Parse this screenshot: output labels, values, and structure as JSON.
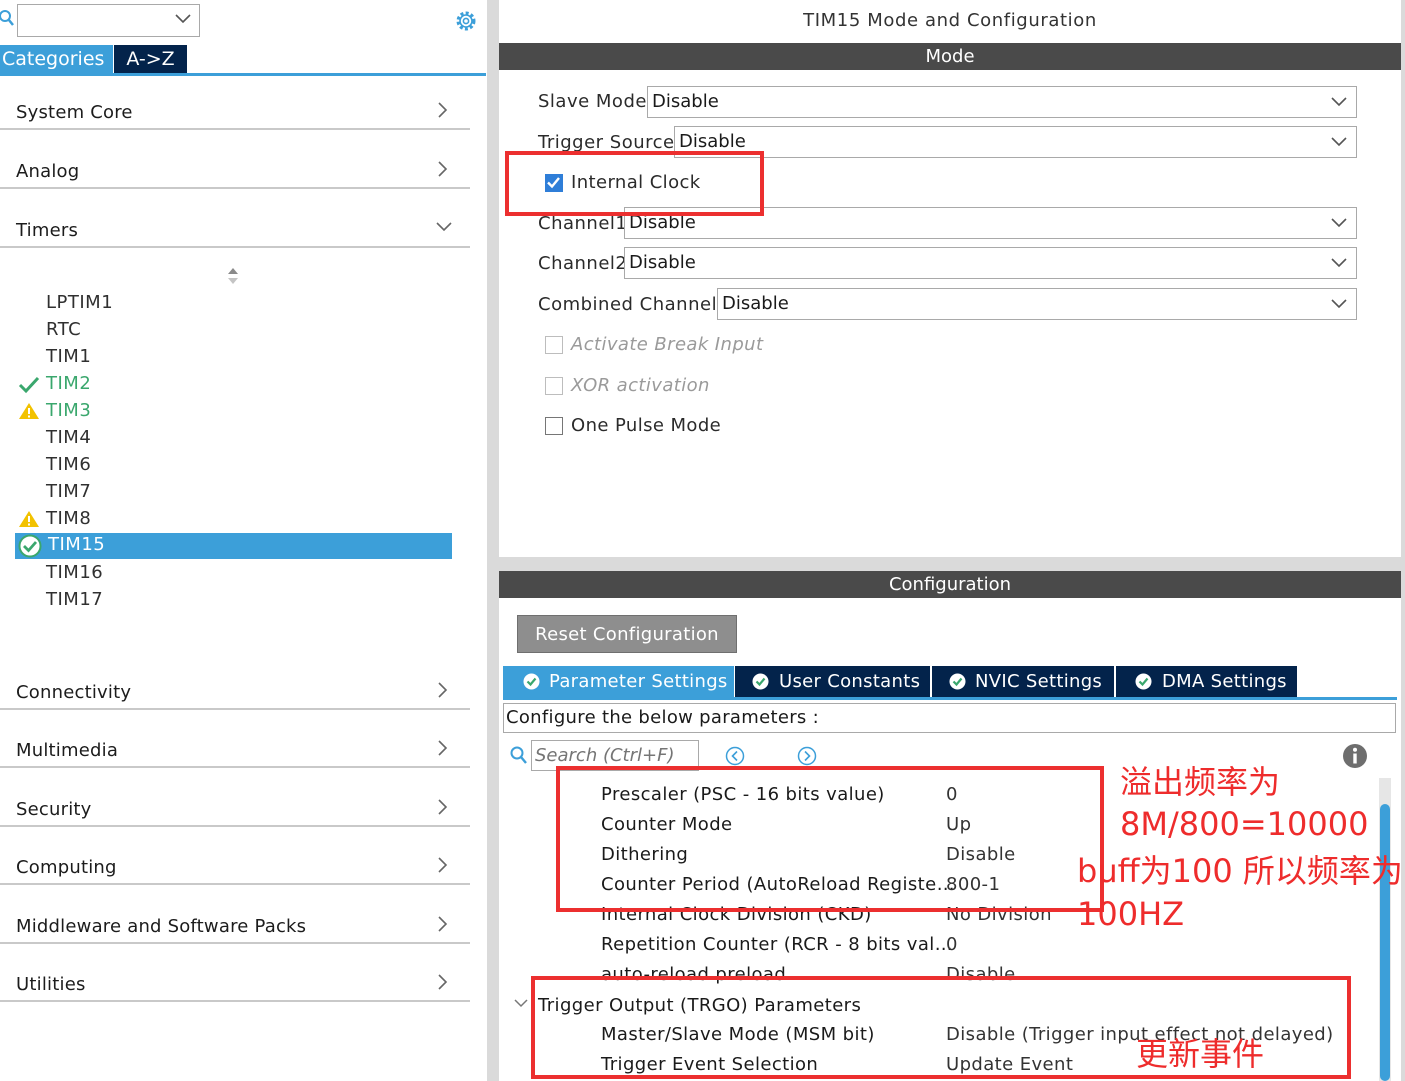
{
  "left_panel": {
    "combo_value": "",
    "tabs": {
      "categories": "Categories",
      "az": "A->Z"
    },
    "categories_top": [
      "System Core",
      "Analog",
      "Timers"
    ],
    "timers": [
      {
        "name": "LPTIM1",
        "status": "none"
      },
      {
        "name": "RTC",
        "status": "none"
      },
      {
        "name": "TIM1",
        "status": "none"
      },
      {
        "name": "TIM2",
        "status": "ok"
      },
      {
        "name": "TIM3",
        "status": "warning"
      },
      {
        "name": "TIM4",
        "status": "none"
      },
      {
        "name": "TIM6",
        "status": "none"
      },
      {
        "name": "TIM7",
        "status": "none"
      },
      {
        "name": "TIM8",
        "status": "warning"
      },
      {
        "name": "TIM15",
        "status": "selected-ok"
      },
      {
        "name": "TIM16",
        "status": "none"
      },
      {
        "name": "TIM17",
        "status": "none"
      }
    ],
    "categories_bottom": [
      "Connectivity",
      "Multimedia",
      "Security",
      "Computing",
      "Middleware and Software Packs",
      "Utilities"
    ]
  },
  "mode": {
    "title": "TIM15 Mode and Configuration",
    "bar": "Mode",
    "slave_mode": {
      "label": "Slave Mode",
      "value": "Disable"
    },
    "trigger_source": {
      "label": "Trigger Source",
      "value": "Disable"
    },
    "internal_clock": {
      "label": "Internal Clock",
      "checked": true
    },
    "channel1": {
      "label": "Channel1",
      "value": "Disable"
    },
    "channel2": {
      "label": "Channel2",
      "value": "Disable"
    },
    "combined_channels": {
      "label": "Combined Channels",
      "value": "Disable"
    },
    "activate_break_input": {
      "label": "Activate Break Input",
      "checked": false,
      "enabled": false
    },
    "xor_activation": {
      "label": "XOR activation",
      "checked": false,
      "enabled": false
    },
    "one_pulse_mode": {
      "label": "One Pulse Mode",
      "checked": false,
      "enabled": true
    }
  },
  "config": {
    "bar": "Configuration",
    "reset_button": "Reset Configuration",
    "tabs": [
      "Parameter Settings",
      "User Constants",
      "NVIC Settings",
      "DMA Settings"
    ],
    "description": "Configure the below parameters :",
    "search_placeholder": "Search (Ctrl+F)",
    "params": [
      {
        "name": "Prescaler (PSC - 16 bits value)",
        "value": "0"
      },
      {
        "name": "Counter Mode",
        "value": "Up"
      },
      {
        "name": "Dithering",
        "value": "Disable"
      },
      {
        "name": "Counter Period (AutoReload Registe…",
        "value": "800-1"
      },
      {
        "name": "Internal Clock Division (CKD)",
        "value": "No Division"
      },
      {
        "name": "Repetition Counter (RCR - 8 bits val…",
        "value": "0"
      },
      {
        "name": "auto-reload preload",
        "value": "Disable"
      }
    ],
    "trgo_group": "Trigger Output (TRGO) Parameters",
    "trgo_params": [
      {
        "name": "Master/Slave Mode (MSM bit)",
        "value": "Disable (Trigger input effect not delayed)"
      },
      {
        "name": "Trigger Event Selection",
        "value": "Update Event"
      }
    ]
  },
  "annotations": {
    "line1": "溢出频率为",
    "line2": "8M/800=10000",
    "line3": "buff为100 所以频率为",
    "line4": "100HZ",
    "update_event": "更新事件",
    "color": "#ee2c2c"
  },
  "colors": {
    "accent": "#3c9fd9",
    "navy": "#03234b",
    "bar": "#4a4a4a",
    "ok": "#3aa76d",
    "warning": "#f2c200"
  }
}
